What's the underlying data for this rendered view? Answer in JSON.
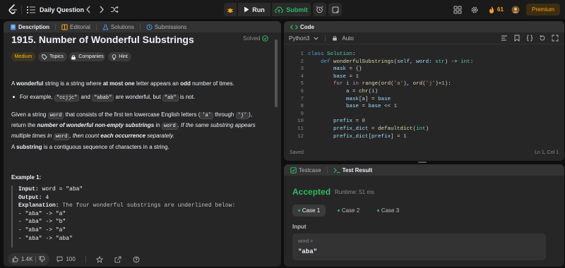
{
  "topbar": {
    "daily_question_label": "Daily Question",
    "run_label": "Run",
    "submit_label": "Submit",
    "streak_count": "61",
    "premium_label": "Premium"
  },
  "description_panel": {
    "tabs": [
      "Description",
      "Editorial",
      "Solutions",
      "Submissions"
    ],
    "title": "1915. Number of Wonderful Substrings",
    "status": "Solved",
    "tags": [
      "Medium",
      "Topics",
      "Companies",
      "Hint"
    ],
    "para1": {
      "a": "A ",
      "b": "wonderful",
      "c": " string is a string where ",
      "d": "at most one",
      "e": " letter appears an ",
      "f": "odd",
      "g": " number of times."
    },
    "bullet": {
      "a": "For example, ",
      "c1": "\"ccjjc\"",
      "b": " and ",
      "c2": "\"abab\"",
      "c": " are wonderful, but ",
      "c3": "\"ab\"",
      "d": " is not."
    },
    "para2": {
      "a": "Given a string ",
      "c1": "word",
      "b": " that consists of the first ten lowercase English letters (",
      "c2": "'a'",
      "c": " through ",
      "c3": "'j'",
      "d": "),",
      "e": "return the ",
      "f": "number of wonderful non-empty substrings",
      "g": " in ",
      "c4": "word",
      "h": ". If the same substring appears",
      "i": "multiple times in ",
      "c5": "word",
      "j": ", then count ",
      "k": "each occurrence",
      "l": " separately."
    },
    "para3": {
      "a": "A ",
      "b": "substring",
      "c": " is a contiguous sequence of characters in a string."
    },
    "example_title": "Example 1:",
    "example": {
      "input_label": "Input:",
      "input_value": " word = \"aba\"",
      "output_label": "Output:",
      "output_value": " 4",
      "explanation_label": "Explanation:",
      "explanation_value": " The four wonderful substrings are underlined below:",
      "lines": [
        "- \"aba\" -> \"a\"",
        "- \"aba\" -> \"b\"",
        "- \"aba\" -> \"a\"",
        "- \"aba\" -> \"aba\""
      ]
    },
    "footer": {
      "likes": "1.4K",
      "comments": "100"
    }
  },
  "code_panel": {
    "title": "Code",
    "language": "Python3",
    "auto_label": "Auto",
    "lines": [
      {
        "n": "1",
        "html": "<span class=\"kw\">class</span> <span class=\"cls\">Solution</span><span class=\"plain\">:</span>"
      },
      {
        "n": "2",
        "html": "    <span class=\"kw\">def</span> <span class=\"fn\">wonderfulSubstrings</span><span class=\"plain\">(</span>self<span class=\"plain\">, </span>word<span class=\"plain\">: </span><span class=\"cls\">str</span><span class=\"plain\">) -&gt; </span><span class=\"cls\">int</span><span class=\"plain\">:</span>"
      },
      {
        "n": "3",
        "html": "        mask <span class=\"plain\">= {}</span>"
      },
      {
        "n": "4",
        "html": "        base <span class=\"plain\">= </span><span class=\"num\">1</span>"
      },
      {
        "n": "5",
        "html": "        <span class=\"kw2\">for</span> i <span class=\"kw2\">in</span> <span class=\"fn\">range</span><span class=\"plain\">(</span><span class=\"fn\">ord</span><span class=\"plain\">(</span><span class=\"str\">'a'</span><span class=\"plain\">), </span><span class=\"fn\">ord</span><span class=\"plain\">(</span><span class=\"str\">'j'</span><span class=\"plain\">)+</span><span class=\"num\">1</span><span class=\"plain\">):</span>"
      },
      {
        "n": "6",
        "html": "            a <span class=\"plain\">= </span><span class=\"fn\">chr</span><span class=\"plain\">(</span>i<span class=\"plain\">)</span>"
      },
      {
        "n": "7",
        "html": "            mask<span class=\"plain\">[</span>a<span class=\"plain\">] = </span>base"
      },
      {
        "n": "8",
        "html": "            base <span class=\"plain\">= </span>base <span class=\"plain\">&lt;&lt; </span><span class=\"num\">1</span>"
      },
      {
        "n": "9",
        "html": ""
      },
      {
        "n": "10",
        "html": "        prefix <span class=\"plain\">= </span><span class=\"num\">0</span>"
      },
      {
        "n": "11",
        "html": "        prefix_dict <span class=\"plain\">= </span><span class=\"fn\">defaultdict</span><span class=\"plain\">(</span><span class=\"cls\">int</span><span class=\"plain\">)</span>"
      },
      {
        "n": "12",
        "html": "        prefix_dict<span class=\"plain\">[</span>prefix<span class=\"plain\">] = </span><span class=\"num\">1</span>"
      }
    ],
    "status_left": "Saved",
    "status_right": "Ln 1, Col 1"
  },
  "result_panel": {
    "tabs": [
      "Testcase",
      "Test Result"
    ],
    "verdict": "Accepted",
    "runtime": "Runtime: 51 ms",
    "cases": [
      "Case 1",
      "Case 2",
      "Case 3"
    ],
    "input_label": "Input",
    "var_label": "word =",
    "var_value": "\"aba\""
  },
  "colors": {
    "accent": "#ffa116",
    "success": "#2cbb5d",
    "medium": "#ffb800"
  }
}
